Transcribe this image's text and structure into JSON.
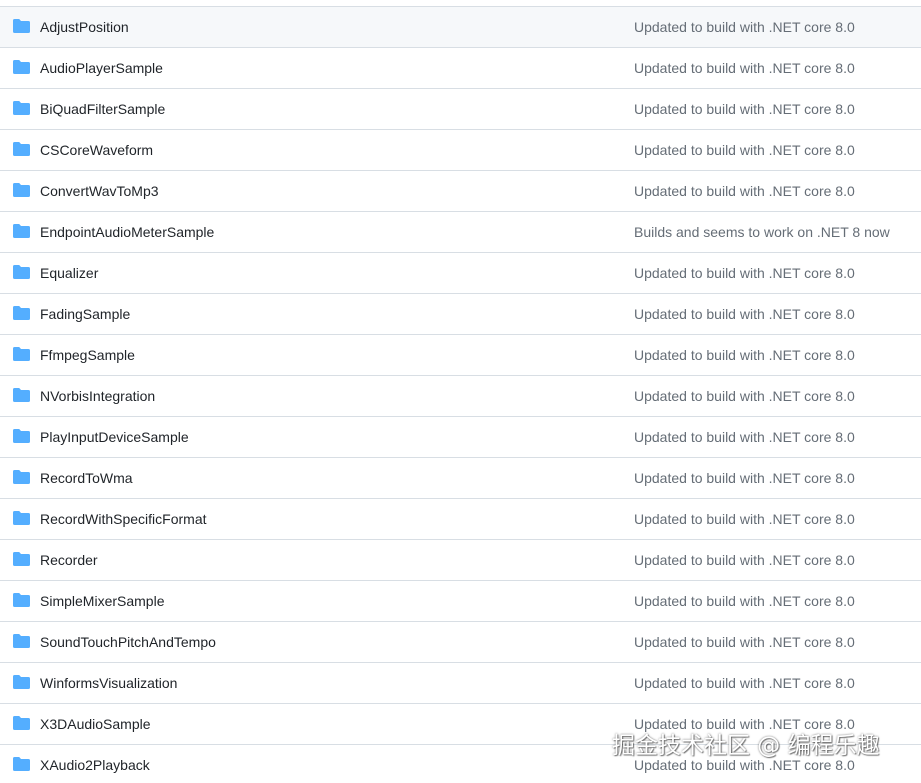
{
  "colors": {
    "folder_icon": "#54aeff",
    "border": "#d8dee4",
    "name_text": "#1f2328",
    "message_text": "#656d76",
    "first_row_background": "#f6f8fa"
  },
  "icons": {
    "folder": "folder-icon"
  },
  "rows": [
    {
      "name": "AdjustPosition",
      "message": "Updated to build with .NET core 8.0"
    },
    {
      "name": "AudioPlayerSample",
      "message": "Updated to build with .NET core 8.0"
    },
    {
      "name": "BiQuadFilterSample",
      "message": "Updated to build with .NET core 8.0"
    },
    {
      "name": "CSCoreWaveform",
      "message": "Updated to build with .NET core 8.0"
    },
    {
      "name": "ConvertWavToMp3",
      "message": "Updated to build with .NET core 8.0"
    },
    {
      "name": "EndpointAudioMeterSample",
      "message": "Builds and seems to work on .NET 8 now"
    },
    {
      "name": "Equalizer",
      "message": "Updated to build with .NET core 8.0"
    },
    {
      "name": "FadingSample",
      "message": "Updated to build with .NET core 8.0"
    },
    {
      "name": "FfmpegSample",
      "message": "Updated to build with .NET core 8.0"
    },
    {
      "name": "NVorbisIntegration",
      "message": "Updated to build with .NET core 8.0"
    },
    {
      "name": "PlayInputDeviceSample",
      "message": "Updated to build with .NET core 8.0"
    },
    {
      "name": "RecordToWma",
      "message": "Updated to build with .NET core 8.0"
    },
    {
      "name": "RecordWithSpecificFormat",
      "message": "Updated to build with .NET core 8.0"
    },
    {
      "name": "Recorder",
      "message": "Updated to build with .NET core 8.0"
    },
    {
      "name": "SimpleMixerSample",
      "message": "Updated to build with .NET core 8.0"
    },
    {
      "name": "SoundTouchPitchAndTempo",
      "message": "Updated to build with .NET core 8.0"
    },
    {
      "name": "WinformsVisualization",
      "message": "Updated to build with .NET core 8.0"
    },
    {
      "name": "X3DAudioSample",
      "message": "Updated to build with .NET core 8.0"
    },
    {
      "name": "XAudio2Playback",
      "message": "Updated to build with .NET core 8.0"
    }
  ],
  "watermark": "掘金技术社区 @ 编程乐趣"
}
